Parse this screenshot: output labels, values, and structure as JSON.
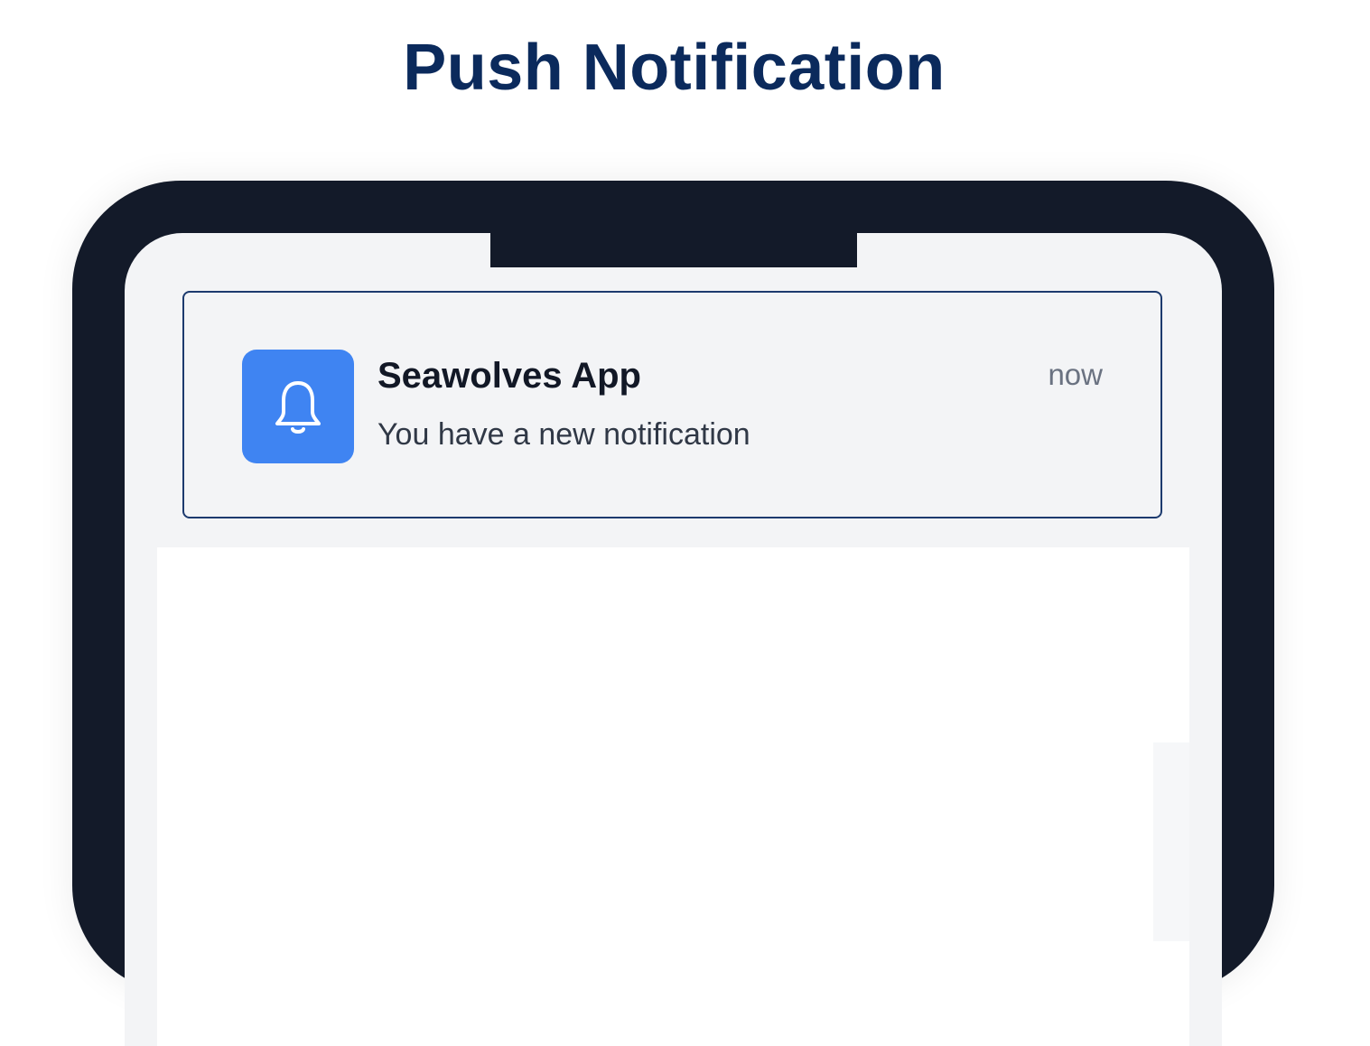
{
  "page": {
    "title": "Push Notification"
  },
  "notification": {
    "app_icon": "bell-icon",
    "app_name": "Seawolves App",
    "message": "You have a new notification",
    "time": "now"
  },
  "colors": {
    "title": "#0b2a5c",
    "phone_frame": "#131a29",
    "screen_bg": "#f3f4f6",
    "card_border": "#1c3a6e",
    "app_icon_bg": "#3f84f2",
    "app_name": "#121826",
    "message": "#303846",
    "time": "#6a7281"
  }
}
